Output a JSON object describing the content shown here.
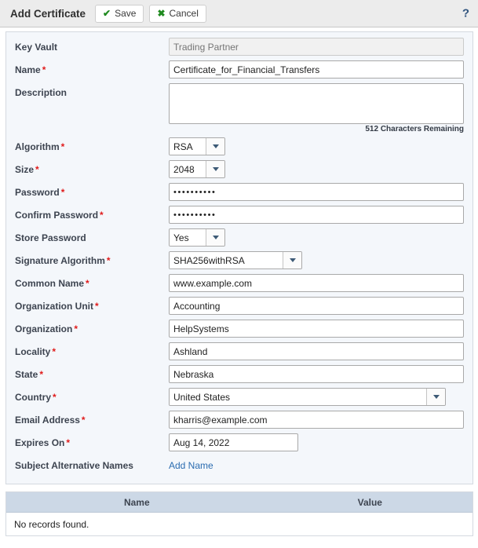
{
  "toolbar": {
    "title": "Add Certificate",
    "save_label": "Save",
    "save_icon": "check-icon",
    "cancel_label": "Cancel",
    "cancel_icon": "x-icon",
    "help_label": "?",
    "accent_green": "#1f8a1f",
    "required_color": "#e01b1b",
    "link_color": "#2b6cb0"
  },
  "form": {
    "key_vault": {
      "label": "Key Vault",
      "required": "",
      "placeholder": "Trading Partner",
      "value": ""
    },
    "name": {
      "label": "Name",
      "required": "*",
      "value": "Certificate_for_Financial_Transfers"
    },
    "description": {
      "label": "Description",
      "required": "",
      "value": "",
      "counter": "512 Characters Remaining"
    },
    "algorithm": {
      "label": "Algorithm",
      "required": "*",
      "value": "RSA"
    },
    "size": {
      "label": "Size",
      "required": "*",
      "value": "2048"
    },
    "password": {
      "label": "Password",
      "required": "*",
      "value": "••••••••••"
    },
    "confirm_password": {
      "label": "Confirm Password",
      "required": "*",
      "value": "••••••••••"
    },
    "store_password": {
      "label": "Store Password",
      "required": "",
      "value": "Yes"
    },
    "signature_algorithm": {
      "label": "Signature Algorithm",
      "required": "*",
      "value": "SHA256withRSA"
    },
    "common_name": {
      "label": "Common Name",
      "required": "*",
      "value": "www.example.com"
    },
    "organization_unit": {
      "label": "Organization Unit",
      "required": "*",
      "value": "Accounting"
    },
    "organization": {
      "label": "Organization",
      "required": "*",
      "value": "HelpSystems"
    },
    "locality": {
      "label": "Locality",
      "required": "*",
      "value": "Ashland"
    },
    "state": {
      "label": "State",
      "required": "*",
      "value": "Nebraska"
    },
    "country": {
      "label": "Country",
      "required": "*",
      "value": "United States"
    },
    "email_address": {
      "label": "Email Address",
      "required": "*",
      "value": "kharris@example.com"
    },
    "expires_on": {
      "label": "Expires On",
      "required": "*",
      "value": "Aug 14, 2022"
    },
    "subject_alternative_names": {
      "label": "Subject Alternative Names",
      "required": "",
      "add_link": "Add Name"
    }
  },
  "grid": {
    "columns": [
      "Name",
      "Value"
    ],
    "empty_message": "No records found.",
    "rows": []
  }
}
